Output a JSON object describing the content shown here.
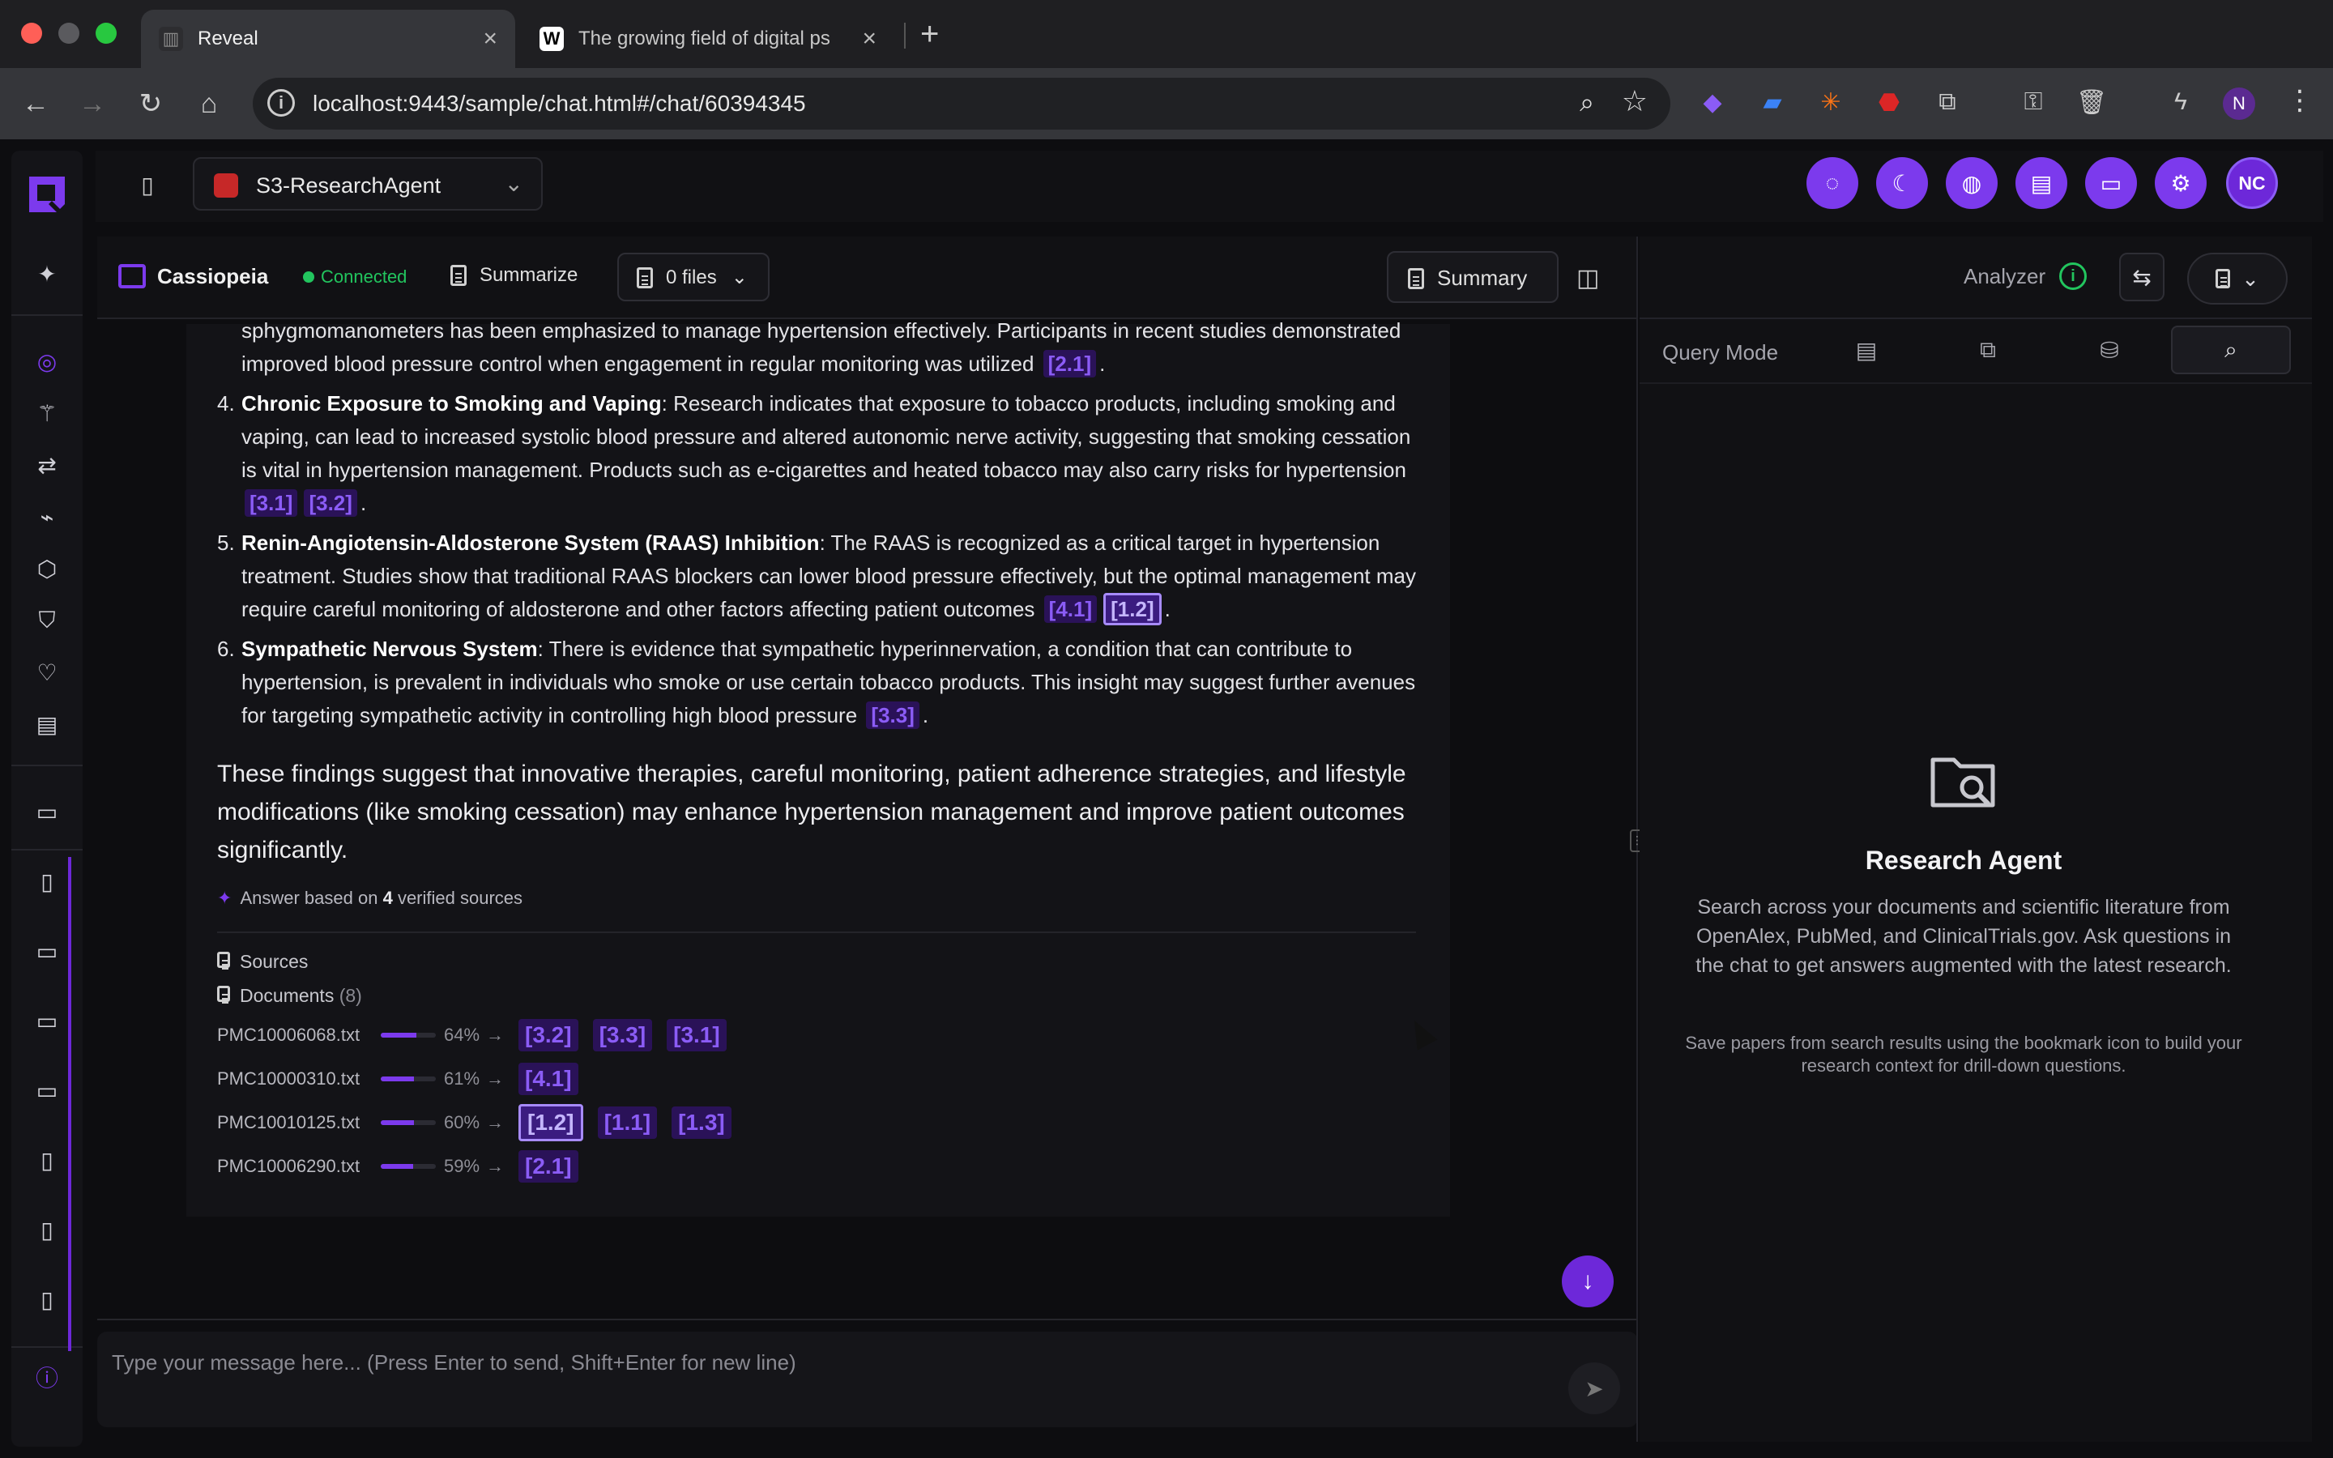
{
  "browser": {
    "tabs": [
      {
        "title": "Reveal",
        "favicon": "reveal-logo",
        "active": true
      },
      {
        "title": "The growing field of digital ps",
        "favicon": "W",
        "active": false
      }
    ],
    "url": "localhost:9443/sample/chat.html#/chat/60394345",
    "profile_initial": "N"
  },
  "app": {
    "agent_name": "S3-ResearchAgent",
    "top_buttons": [
      "chat-bubble-icon",
      "moon-icon",
      "palette-icon",
      "document-icon",
      "message-icon",
      "gear-icon"
    ],
    "avatar_initials": "NC",
    "accent": "#7c3aed"
  },
  "chat": {
    "title": "Cassiopeia",
    "status": "Connected",
    "summarize_label": "Summarize",
    "files_label": "0 files",
    "summary_label": "Summary",
    "top_fragment": "sphygmomanometers has been emphasized to manage hypertension effectively. Participants in recent studies demonstrated improved blood pressure control when engagement in regular monitoring was utilized",
    "top_fragment_cites": [
      "[2.1]"
    ],
    "items": [
      {
        "num": "4.",
        "heading": "Chronic Exposure to Smoking and Vaping",
        "text": ": Research indicates that exposure to tobacco products, including smoking and vaping, can lead to increased systolic blood pressure and altered autonomic nerve activity, suggesting that smoking cessation is vital in hypertension management. Products such as e-cigarettes and heated tobacco may also carry risks for hypertension",
        "cites": [
          "[3.1]",
          "[3.2]"
        ]
      },
      {
        "num": "5.",
        "heading": "Renin-Angiotensin-Aldosterone System (RAAS) Inhibition",
        "text": ": The RAAS is recognized as a critical target in hypertension treatment. Studies show that traditional RAAS blockers can lower blood pressure effectively, but the optimal management may require careful monitoring of aldosterone and other factors affecting patient outcomes",
        "cites": [
          "[4.1]",
          "[1.2]"
        ]
      },
      {
        "num": "6.",
        "heading": "Sympathetic Nervous System",
        "text": ": There is evidence that sympathetic hyperinnervation, a condition that can contribute to hypertension, is prevalent in individuals who smoke or use certain tobacco products. This insight may suggest further avenues for targeting sympathetic activity in controlling high blood pressure",
        "cites": [
          "[3.3]"
        ]
      }
    ],
    "conclusion": "These findings suggest that innovative therapies, careful monitoring, patient adherence strategies, and lifestyle modifications (like smoking cessation) may enhance hypertension management and improve patient outcomes significantly.",
    "verified_prefix": "Answer based on",
    "verified_count": "4",
    "verified_suffix": "verified sources",
    "sources_label": "Sources",
    "documents_label": "Documents",
    "documents_count": "(8)",
    "sources": [
      {
        "file": "PMC10006068.txt",
        "pct": "64%",
        "score": 0.64,
        "cites": [
          "[3.2]",
          "[3.3]",
          "[3.1]"
        ]
      },
      {
        "file": "PMC10000310.txt",
        "pct": "61%",
        "score": 0.61,
        "cites": [
          "[4.1]"
        ]
      },
      {
        "file": "PMC10010125.txt",
        "pct": "60%",
        "score": 0.6,
        "cites": [
          "[1.2]",
          "[1.1]",
          "[1.3]"
        ]
      },
      {
        "file": "PMC10006290.txt",
        "pct": "59%",
        "score": 0.59,
        "cites": [
          "[2.1]"
        ]
      }
    ],
    "composer_placeholder": "Type your message here... (Press Enter to send, Shift+Enter for new line)"
  },
  "right_panel": {
    "analyzer_label": "Analyzer",
    "query_mode_label": "Query Mode",
    "empty_title": "Research Agent",
    "empty_desc": "Search across your documents and scientific literature from OpenAlex, PubMed, and ClinicalTrials.gov. Ask questions in the chat to get answers augmented with the latest research.",
    "empty_note": "Save papers from search results using the bookmark icon to build your research context for drill-down questions."
  }
}
